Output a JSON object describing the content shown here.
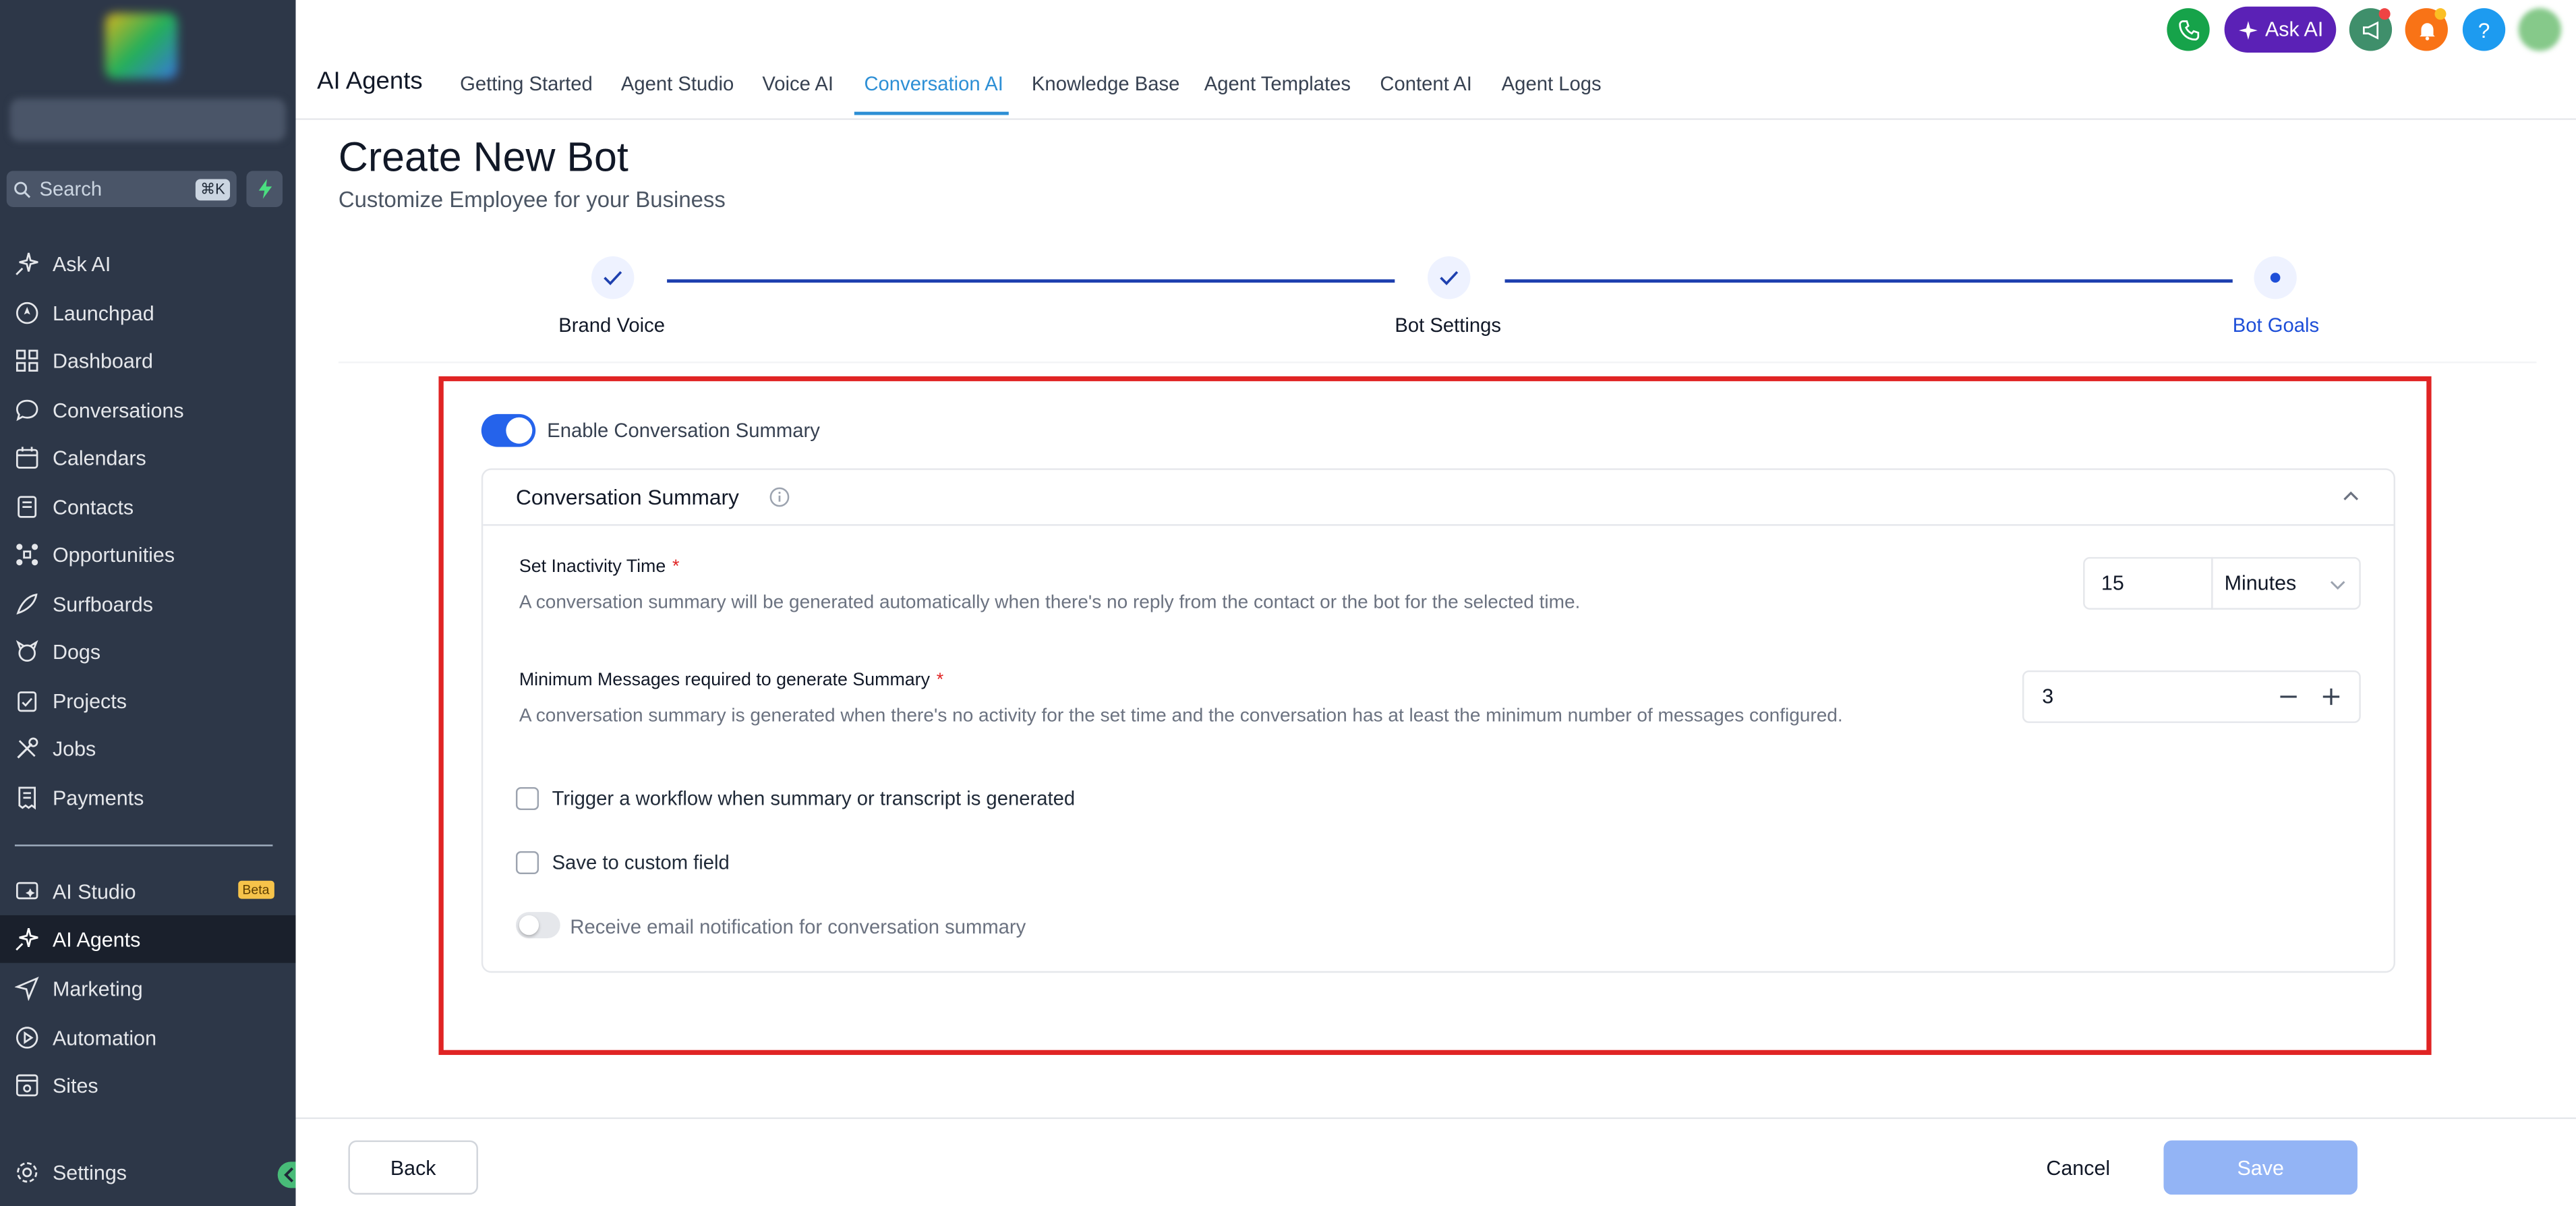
{
  "sidebar": {
    "search_placeholder": "Search",
    "search_shortcut": "⌘K",
    "items": [
      {
        "label": "Ask AI",
        "icon": "sparkle-icon"
      },
      {
        "label": "Launchpad",
        "icon": "rocket-icon"
      },
      {
        "label": "Dashboard",
        "icon": "grid-icon"
      },
      {
        "label": "Conversations",
        "icon": "chat-bubble-icon"
      },
      {
        "label": "Calendars",
        "icon": "calendar-icon"
      },
      {
        "label": "Contacts",
        "icon": "contacts-icon"
      },
      {
        "label": "Opportunities",
        "icon": "opportunities-icon"
      },
      {
        "label": "Surfboards",
        "icon": "surfboard-icon"
      },
      {
        "label": "Dogs",
        "icon": "dog-icon"
      },
      {
        "label": "Projects",
        "icon": "clipboard-icon"
      },
      {
        "label": "Jobs",
        "icon": "tools-icon"
      },
      {
        "label": "Payments",
        "icon": "receipt-icon"
      }
    ],
    "items2": [
      {
        "label": "AI Studio",
        "icon": "ai-studio-icon",
        "badge": "Beta"
      },
      {
        "label": "AI Agents",
        "icon": "sparkle-icon"
      },
      {
        "label": "Marketing",
        "icon": "send-icon"
      },
      {
        "label": "Automation",
        "icon": "automation-icon"
      },
      {
        "label": "Sites",
        "icon": "sites-icon"
      }
    ],
    "settings_label": "Settings"
  },
  "header": {
    "title": "AI Agents",
    "tabs": [
      "Getting Started",
      "Agent Studio",
      "Voice AI",
      "Conversation AI",
      "Knowledge Base",
      "Agent Templates",
      "Content AI",
      "Agent Logs"
    ],
    "active_tab": "Conversation AI",
    "ask_ai_label": "Ask AI",
    "help_label": "?"
  },
  "page": {
    "title": "Create New Bot",
    "subtitle": "Customize Employee for your Business"
  },
  "stepper": {
    "steps": [
      "Brand Voice",
      "Bot Settings",
      "Bot Goals"
    ],
    "current_step": "Bot Goals"
  },
  "summary": {
    "enable_label": "Enable Conversation Summary",
    "enabled": true,
    "card_title": "Conversation Summary",
    "inactivity": {
      "label": "Set Inactivity Time",
      "required_mark": "*",
      "description": "A conversation summary will be generated automatically when there's no reply from the contact or the bot for the selected time.",
      "value": "15",
      "unit": "Minutes"
    },
    "min_messages": {
      "label": "Minimum Messages required to generate Summary",
      "required_mark": "*",
      "description": "A conversation summary is generated when there's no activity for the set time and the conversation has at least the minimum number of messages configured.",
      "value": "3"
    },
    "trigger_workflow_label": "Trigger a workflow when summary or transcript is generated",
    "trigger_workflow_checked": false,
    "save_custom_field_label": "Save to custom field",
    "save_custom_field_checked": false,
    "email_notification_label": "Receive email notification for conversation summary",
    "email_notification_enabled": false
  },
  "footer": {
    "back_label": "Back",
    "cancel_label": "Cancel",
    "save_label": "Save"
  },
  "colors": {
    "accent": "#2563eb",
    "sidebar_bg": "#2d3748",
    "highlight_border": "#e02424",
    "ask_ai_bg": "#5b21b6",
    "save_disabled": "#93b4f5"
  }
}
